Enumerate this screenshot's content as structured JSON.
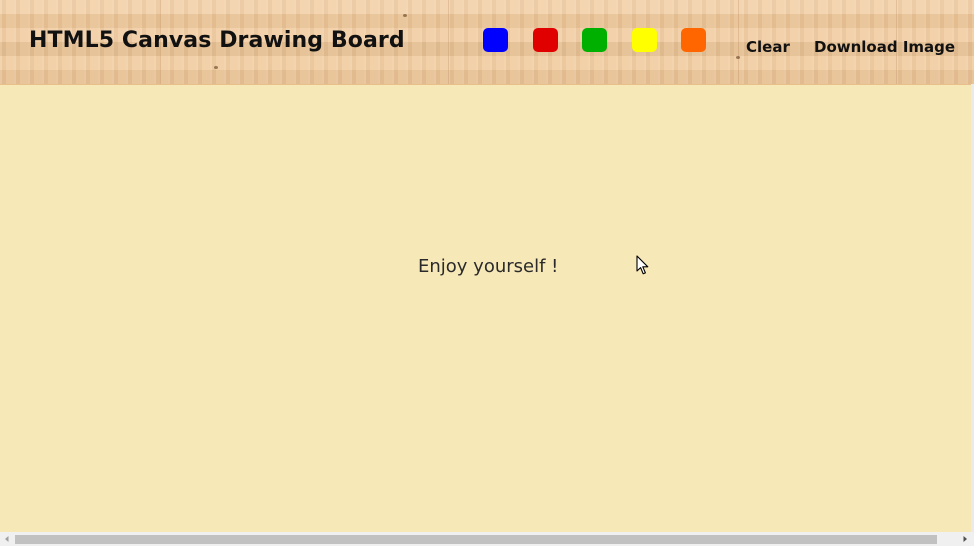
{
  "header": {
    "title": "HTML5 Canvas Drawing Board",
    "colors": [
      {
        "name": "blue",
        "hex": "#0000ff",
        "icon": "color-swatch-blue"
      },
      {
        "name": "red",
        "hex": "#e00000",
        "icon": "color-swatch-red"
      },
      {
        "name": "green",
        "hex": "#00b000",
        "icon": "color-swatch-green"
      },
      {
        "name": "yellow",
        "hex": "#ffff00",
        "icon": "color-swatch-yellow"
      },
      {
        "name": "orange",
        "hex": "#ff6600",
        "icon": "color-swatch-orange"
      }
    ],
    "clear_label": "Clear",
    "download_label": "Download Image"
  },
  "board": {
    "message": "Enjoy yourself !",
    "background": "#f7e8b8"
  },
  "theme": {
    "header_wood": "#f0c99b"
  }
}
